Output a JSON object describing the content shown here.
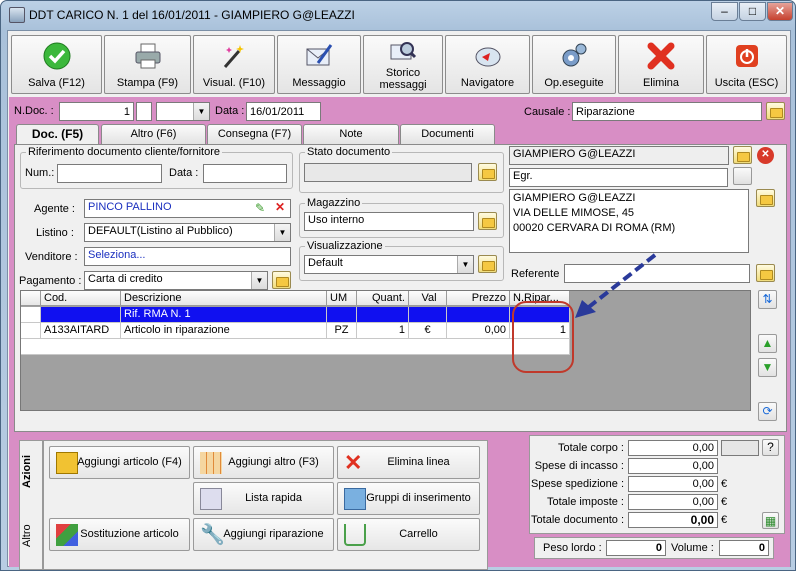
{
  "window": {
    "title": "DDT CARICO N. 1  del 16/01/2011 - GIAMPIERO G@LEAZZI"
  },
  "toolbar": [
    {
      "label": "Salva (F12)",
      "icon": "check-icon"
    },
    {
      "label": "Stampa (F9)",
      "icon": "printer-icon"
    },
    {
      "label": "Visual. (F10)",
      "icon": "magic-wand-icon"
    },
    {
      "label": "Messaggio",
      "icon": "envelope-pen-icon"
    },
    {
      "label_l1": "Storico",
      "label_l2": "messaggi",
      "icon": "envelope-search-icon"
    },
    {
      "label": "Navigatore",
      "icon": "compass-icon"
    },
    {
      "label": "Op.eseguite",
      "icon": "gears-icon"
    },
    {
      "label": "Elimina",
      "icon": "red-x-icon"
    },
    {
      "label": "Uscita (ESC)",
      "icon": "power-icon"
    }
  ],
  "header": {
    "ndoc_label": "N.Doc. :",
    "ndoc_value": "1",
    "data_label": "Data :",
    "data_value": "16/01/2011",
    "causale_label": "Causale :",
    "causale_value": "Riparazione"
  },
  "tabs": [
    "Doc. (F5)",
    "Altro (F6)",
    "Consegna (F7)",
    "Note",
    "Documenti"
  ],
  "riferimento": {
    "title": "Riferimento documento cliente/fornitore",
    "num_label": "Num.:",
    "data_label": "Data :"
  },
  "agente": {
    "label": "Agente :",
    "value": "PINCO PALLINO"
  },
  "listino": {
    "label": "Listino :",
    "value": "DEFAULT(Listino al Pubblico)"
  },
  "venditore": {
    "label": "Venditore :",
    "value": "Seleziona..."
  },
  "pagamento": {
    "label": "Pagamento :",
    "value": "Carta di credito"
  },
  "stato": {
    "title": "Stato documento"
  },
  "magazzino": {
    "title": "Magazzino",
    "value": "Uso interno"
  },
  "visualizzazione": {
    "title": "Visualizzazione",
    "value": "Default"
  },
  "cliente": {
    "name": "GIAMPIERO G@LEAZZI",
    "code": "Egr.",
    "address": [
      "GIAMPIERO G@LEAZZI",
      "VIA DELLE MIMOSE, 45",
      "00020 CERVARA DI ROMA (RM)"
    ],
    "referente_label": "Referente"
  },
  "grid": {
    "headers": [
      "Cod.",
      "Descrizione",
      "UM",
      "Quant.",
      "Val",
      "Prezzo",
      "N.Ripar..."
    ],
    "rows": [
      {
        "cod": "",
        "desc": "Rif. RMA N. 1",
        "um": "",
        "qty": "",
        "val": "",
        "price": "",
        "nrip": ""
      },
      {
        "cod": "A133AITARD",
        "desc": "Articolo in riparazione",
        "um": "PZ",
        "qty": "1",
        "val": "€",
        "price": "0,00",
        "nrip": "1"
      }
    ]
  },
  "actions": {
    "tab_azioni": "Azioni",
    "tab_altro": "Altro",
    "buttons": [
      "Aggiungi articolo (F4)",
      "Aggiungi altro (F3)",
      "Elimina linea",
      "Lista rapida",
      "Gruppi di inserimento",
      "Sostituzione articolo",
      "Aggiungi riparazione",
      "Carrello"
    ]
  },
  "totals": {
    "corpo_label": "Totale corpo :",
    "corpo": "0,00",
    "incasso_label": "Spese di incasso :",
    "incasso": "0,00",
    "spedizione_label": "Spese spedizione :",
    "spedizione": "0,00",
    "spedizione_cur": "€",
    "imposte_label": "Totale imposte :",
    "imposte": "0,00",
    "imposte_cur": "€",
    "documento_label": "Totale documento :",
    "documento": "0,00",
    "documento_cur": "€",
    "peso_label": "Peso lordo :",
    "peso": "0",
    "volume_label": "Volume :",
    "volume": "0",
    "help": "?"
  },
  "colors": {
    "pink": "#d88ec5",
    "selected_row": "#0000ff",
    "arrow": "#2a3a9a",
    "circle": "#c0392b"
  }
}
